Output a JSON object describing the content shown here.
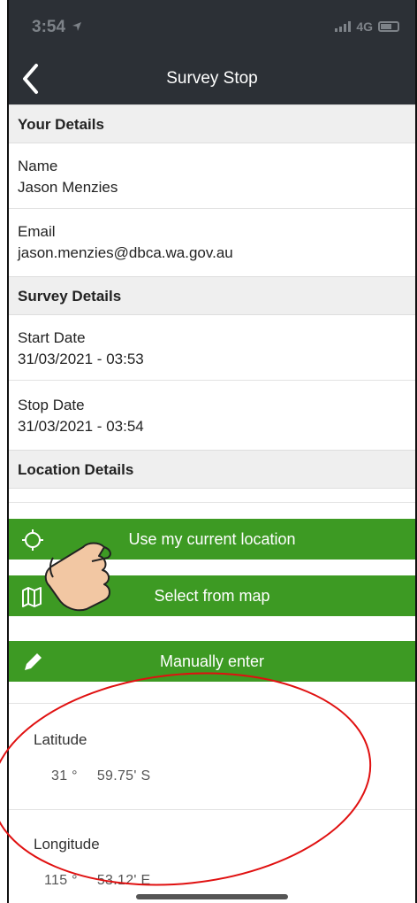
{
  "status_bar": {
    "time": "3:54",
    "network": "4G"
  },
  "nav": {
    "title": "Survey Stop"
  },
  "sections": {
    "your_details": "Your Details",
    "survey_details": "Survey Details",
    "location_details": "Location Details"
  },
  "fields": {
    "name": {
      "label": "Name",
      "value": "Jason Menzies"
    },
    "email": {
      "label": "Email",
      "value": "jason.menzies@dbca.wa.gov.au"
    },
    "start_date": {
      "label": "Start Date",
      "value": "31/03/2021 - 03:53"
    },
    "stop_date": {
      "label": "Stop Date",
      "value": "31/03/2021 - 03:54"
    }
  },
  "buttons": {
    "current_location": "Use my current location",
    "select_map": "Select from map",
    "manual_enter": "Manually enter"
  },
  "latitude": {
    "label": "Latitude",
    "degrees": "31 °",
    "minutes": "59.75' S"
  },
  "longitude": {
    "label": "Longitude",
    "degrees": "115 °",
    "minutes": "53.12' E"
  },
  "colors": {
    "nav_bg": "#2c3036",
    "button_green": "#3d9a23",
    "annotation_red": "#e01010"
  }
}
